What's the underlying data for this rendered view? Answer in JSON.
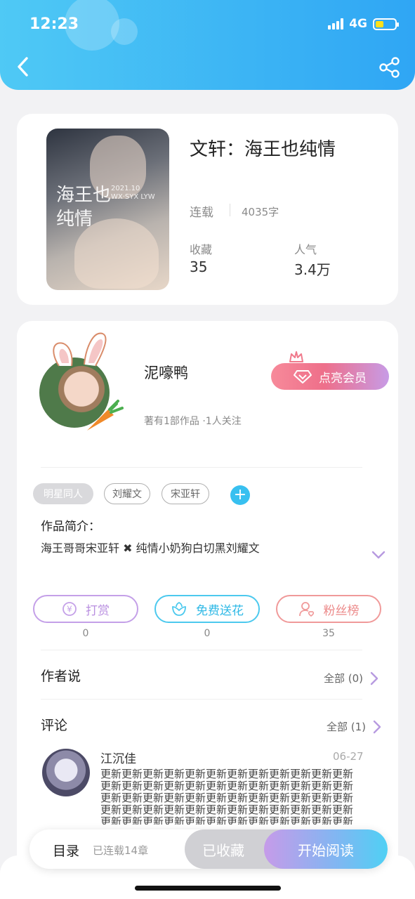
{
  "status_bar": {
    "time": "12:23",
    "network": "4G"
  },
  "book": {
    "title": "文轩：海王也纯情",
    "cover_title": "海王也纯情",
    "cover_sub": "2021.10 WX·SYX LYW",
    "status": "连载",
    "word_count": "4035字",
    "favorites_label": "收藏",
    "favorites_value": "35",
    "popularity_label": "人气",
    "popularity_value": "3.4万"
  },
  "author": {
    "name": "泥嚎鸭",
    "meta": "著有1部作品 ·1人关注",
    "vip_label": "点亮会员"
  },
  "tags": [
    "明星同人",
    "刘耀文",
    "宋亚轩"
  ],
  "intro": {
    "title": "作品简介：",
    "text": "海王哥哥宋亚轩 ✖ 纯情小奶狗白切黑刘耀文"
  },
  "actions": [
    {
      "label": "打赏",
      "count": "0",
      "color": "#c4a0e8"
    },
    {
      "label": "免费送花",
      "count": "0",
      "color": "#4cc9ee"
    },
    {
      "label": "粉丝榜",
      "count": "35",
      "color": "#f09a9a"
    }
  ],
  "author_says": {
    "title": "作者说",
    "link": "全部 (0)"
  },
  "comments": {
    "title": "评论",
    "link": "全部 (1)",
    "items": [
      {
        "name": "江沉佳",
        "date": "06-27",
        "text": "更新更新更新更新更新更新更新更新更新更新更新更新更新更新更新更新更新更新更新更新更新更新更新更新更新更新更新更新更新更新更新更新更新更新更新更新更新更新更新更新更新更新更新更新更新更新更新更新更新更新更新更新更新更新更新更新更新更新更新更新更新更新更新更新更新"
      }
    ]
  },
  "bottom": {
    "toc_label": "目录",
    "toc_sub": "已连载14章",
    "favorited_label": "已收藏",
    "read_label": "开始阅读"
  }
}
